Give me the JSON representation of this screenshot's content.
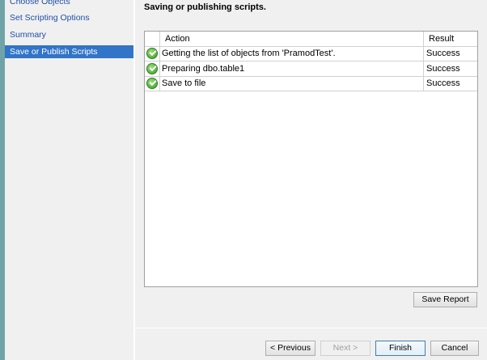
{
  "sidebar": {
    "items": [
      {
        "label": "Choose Objects"
      },
      {
        "label": "Set Scripting Options"
      },
      {
        "label": "Summary"
      },
      {
        "label": "Save or Publish Scripts",
        "active": true
      }
    ]
  },
  "main": {
    "title": "Saving or publishing scripts.",
    "table": {
      "columns": [
        "Action",
        "Result"
      ],
      "rows": [
        {
          "icon": "success-check-icon",
          "action": "Getting the list of objects from 'PramodTest'.",
          "result": "Success"
        },
        {
          "icon": "success-check-icon",
          "action": "Preparing dbo.table1",
          "result": "Success"
        },
        {
          "icon": "success-check-icon",
          "action": "Save to file",
          "result": "Success"
        }
      ]
    },
    "save_report": "Save Report"
  },
  "footer": {
    "previous": "< Previous",
    "next": "Next >",
    "finish": "Finish",
    "cancel": "Cancel"
  },
  "colors": {
    "accent": "#3174c8",
    "link": "#1f4fa8"
  }
}
